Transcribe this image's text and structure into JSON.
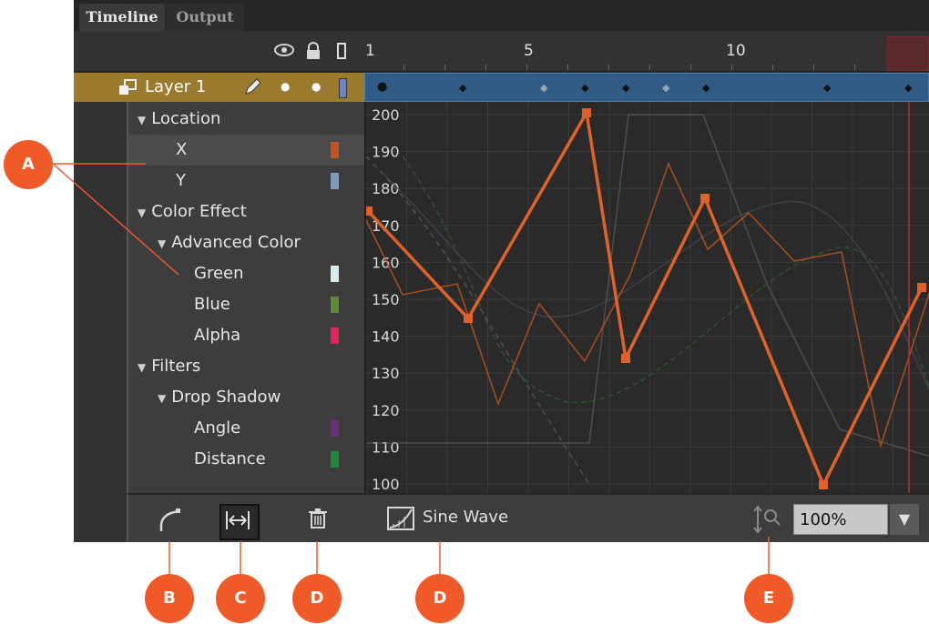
{
  "tabs": [
    {
      "label": "Timeline"
    },
    {
      "label": "Output"
    }
  ],
  "header": {
    "icons": [
      "eye-icon",
      "lock-icon",
      "outline-icon"
    ],
    "frame_numbers": [
      "1",
      "5",
      "10"
    ]
  },
  "layer": {
    "name": "Layer 1"
  },
  "properties": [
    {
      "label": "Location",
      "level": 0,
      "expanded": true
    },
    {
      "label": "X",
      "level": 1,
      "color": "#c6521f"
    },
    {
      "label": "Y",
      "level": 1,
      "color": "#7f9cc0"
    },
    {
      "label": "Color Effect",
      "level": 0,
      "expanded": true
    },
    {
      "label": "Advanced Color",
      "level": 1,
      "expanded": true
    },
    {
      "label": "Green",
      "level": 2,
      "color": "#d7ecec"
    },
    {
      "label": "Blue",
      "level": 2,
      "color": "#5f8a34"
    },
    {
      "label": "Alpha",
      "level": 2,
      "color": "#e3245a"
    },
    {
      "label": "Filters",
      "level": 0,
      "expanded": true
    },
    {
      "label": "Drop Shadow",
      "level": 1,
      "expanded": true
    },
    {
      "label": "Angle",
      "level": 2,
      "color": "#6a2f7a"
    },
    {
      "label": "Distance",
      "level": 2,
      "color": "#1e8a3a"
    }
  ],
  "graph": {
    "y_ticks": [
      "200",
      "190",
      "180",
      "170",
      "160",
      "150",
      "140",
      "130",
      "120",
      "110",
      "100"
    ],
    "ylim": [
      100,
      200
    ],
    "accent": "#e0622a"
  },
  "toolbar": {
    "ease_label": "Sine Wave",
    "zoom_value": "100%"
  },
  "callouts": {
    "a": "A",
    "b": "B",
    "c": "C",
    "d1": "D",
    "d2": "D",
    "e": "E"
  }
}
